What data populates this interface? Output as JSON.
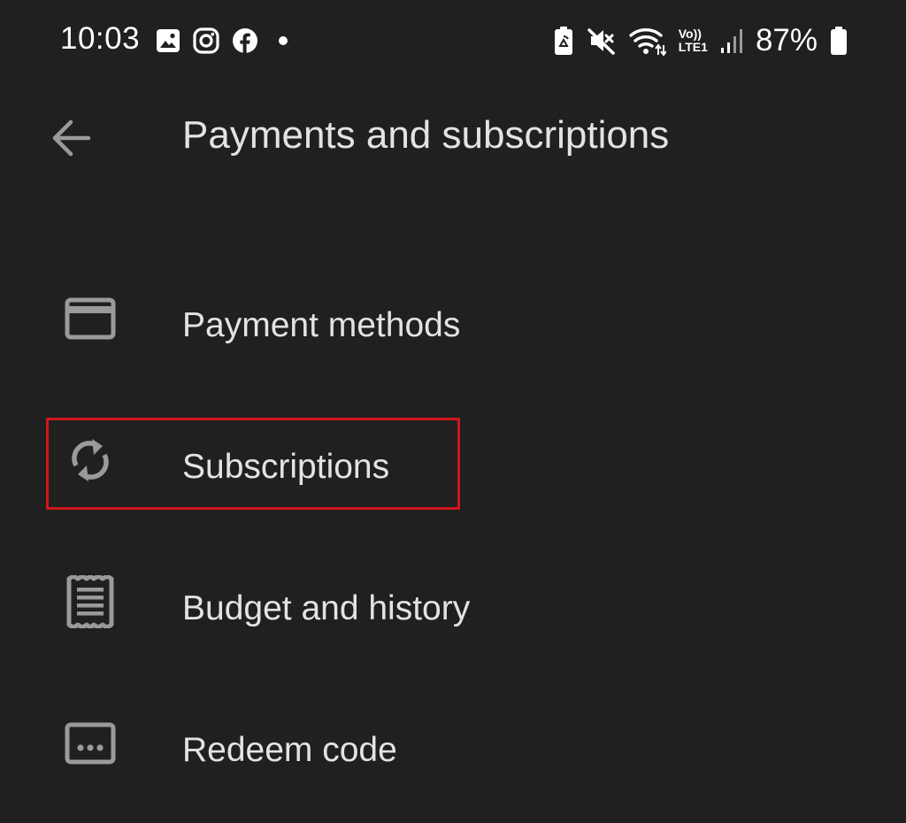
{
  "status_bar": {
    "time": "10:03",
    "battery_percent": "87%",
    "network_label_top": "Vo))",
    "network_label_bottom": "LTE1",
    "left_icons": [
      "gallery-icon",
      "instagram-icon",
      "facebook-icon",
      "notification-dot-icon"
    ],
    "right_icons": [
      "battery-saver-icon",
      "mute-icon",
      "wifi-icon",
      "volte-icon",
      "signal-icon",
      "battery-icon"
    ]
  },
  "app_bar": {
    "back_icon": "arrow-back-icon",
    "title": "Payments and subscriptions"
  },
  "menu": {
    "items": [
      {
        "label": "Payment methods",
        "icon": "credit-card-icon"
      },
      {
        "label": "Subscriptions",
        "icon": "sync-icon",
        "highlighted": true
      },
      {
        "label": "Budget and history",
        "icon": "receipt-icon"
      },
      {
        "label": "Redeem code",
        "icon": "redeem-code-icon"
      }
    ]
  },
  "colors": {
    "background": "#202020",
    "text": "#e3e3e3",
    "icon": "#9a9a9a",
    "highlight_border": "#d0161b"
  }
}
